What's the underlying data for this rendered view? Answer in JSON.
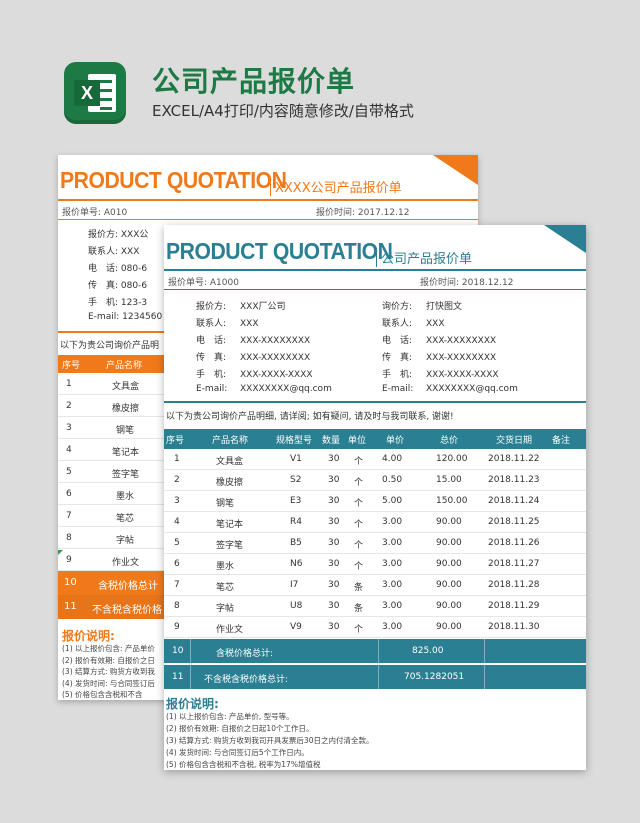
{
  "header": {
    "icon_name": "excel-icon",
    "title": "公司产品报价单",
    "subtitle": "EXCEL/A4打印/内容随意修改/自带格式"
  },
  "colors": {
    "green": "#1e7a45",
    "orange": "#f07a1a",
    "teal": "#2b7f92"
  },
  "back_sheet": {
    "title": "PRODUCT QUOTATION",
    "subtitle": "XXXX公司产品报价单",
    "quote_no": "报价单号: A010",
    "quote_time": "报价时间: 2017.12.12",
    "contacts": [
      "报价方: XXX公",
      "联系人: XXX",
      "电　话: 080-6",
      "传　真: 080-6",
      "手　机: 123-3",
      "E-mail: 1234560"
    ],
    "note": "以下为贵公司询价产品明",
    "headers": [
      "序号",
      "产品名称"
    ],
    "rows": [
      {
        "no": "1",
        "name": "文具盒"
      },
      {
        "no": "2",
        "name": "橡皮擦"
      },
      {
        "no": "3",
        "name": "钢笔"
      },
      {
        "no": "4",
        "name": "笔记本"
      },
      {
        "no": "5",
        "name": "签字笔"
      },
      {
        "no": "6",
        "name": "墨水"
      },
      {
        "no": "7",
        "name": "笔芯"
      },
      {
        "no": "8",
        "name": "字帖"
      },
      {
        "no": "9",
        "name": "作业文"
      }
    ],
    "sum_rows": [
      {
        "no": "10",
        "label": "含税价格总计"
      },
      {
        "no": "11",
        "label": "不含税含税价格"
      }
    ],
    "notes_title": "报价说明:",
    "notes": [
      "(1)  以上报价包含: 产品单价",
      "(2)  报价有效期: 自报价之日",
      "(3)  结算方式: 购货方收到我",
      "(4)  发货时间: 与合同签订后",
      "(5)  价格包含含税和不含"
    ]
  },
  "front_sheet": {
    "title": "PRODUCT QUOTATION",
    "subtitle": "公司产品报价单",
    "quote_no": "报价单号: A1000",
    "quote_time": "报价时间: 2018.12.12",
    "left_contacts": [
      {
        "label": "报价方:",
        "value": "XXX厂公司"
      },
      {
        "label": "联系人:",
        "value": "XXX"
      },
      {
        "label": "电　话:",
        "value": "XXX-XXXXXXXX"
      },
      {
        "label": "传　真:",
        "value": "XXX-XXXXXXXX"
      },
      {
        "label": "手　机:",
        "value": "XXX-XXXX-XXXX"
      },
      {
        "label": "E-mail:",
        "value": "XXXXXXXX@qq.com"
      }
    ],
    "right_contacts": [
      {
        "label": "询价方:",
        "value": "打快图文"
      },
      {
        "label": "联系人:",
        "value": "XXX"
      },
      {
        "label": "电　话:",
        "value": "XXX-XXXXXXXX"
      },
      {
        "label": "传　真:",
        "value": "XXX-XXXXXXXX"
      },
      {
        "label": "手　机:",
        "value": "XXX-XXXX-XXXX"
      },
      {
        "label": "E-mail:",
        "value": "XXXXXXXX@qq.com"
      }
    ],
    "note": "以下为贵公司询价产品明细, 请详阅; 如有疑问, 请及时与我司联系, 谢谢!",
    "headers": [
      "序号",
      "产品名称",
      "规格型号",
      "数量",
      "单位",
      "单价",
      "总价",
      "交货日期",
      "备注"
    ],
    "rows": [
      {
        "no": "1",
        "name": "文具盒",
        "model": "V1",
        "qty": "30",
        "unit": "个",
        "price": "4.00",
        "total": "120.00",
        "date": "2018.11.22"
      },
      {
        "no": "2",
        "name": "橡皮擦",
        "model": "S2",
        "qty": "30",
        "unit": "个",
        "price": "0.50",
        "total": "15.00",
        "date": "2018.11.23"
      },
      {
        "no": "3",
        "name": "钢笔",
        "model": "E3",
        "qty": "30",
        "unit": "个",
        "price": "5.00",
        "total": "150.00",
        "date": "2018.11.24"
      },
      {
        "no": "4",
        "name": "笔记本",
        "model": "R4",
        "qty": "30",
        "unit": "个",
        "price": "3.00",
        "total": "90.00",
        "date": "2018.11.25"
      },
      {
        "no": "5",
        "name": "签字笔",
        "model": "B5",
        "qty": "30",
        "unit": "个",
        "price": "3.00",
        "total": "90.00",
        "date": "2018.11.26"
      },
      {
        "no": "6",
        "name": "墨水",
        "model": "N6",
        "qty": "30",
        "unit": "个",
        "price": "3.00",
        "total": "90.00",
        "date": "2018.11.27"
      },
      {
        "no": "7",
        "name": "笔芯",
        "model": "I7",
        "qty": "30",
        "unit": "条",
        "price": "3.00",
        "total": "90.00",
        "date": "2018.11.28"
      },
      {
        "no": "8",
        "name": "字帖",
        "model": "U8",
        "qty": "30",
        "unit": "条",
        "price": "3.00",
        "total": "90.00",
        "date": "2018.11.29"
      },
      {
        "no": "9",
        "name": "作业文",
        "model": "V9",
        "qty": "30",
        "unit": "个",
        "price": "3.00",
        "total": "90.00",
        "date": "2018.11.30"
      }
    ],
    "sum_rows": [
      {
        "no": "10",
        "label": "含税价格总计:",
        "value": "825.00"
      },
      {
        "no": "11",
        "label": "不含税含税价格总计:",
        "value": "705.1282051"
      }
    ],
    "notes_title": "报价说明:",
    "notes": [
      "(1)  以上报价包含: 产品单价, 型号等。",
      "(2)  报价有效期: 自报价之日起10个工作日。",
      "(3)  结算方式: 购货方收到我司开具发票后30日之内付清全款。",
      "(4)  发货时间: 与合同签订后5个工作日内。",
      "(5)  价格包含含税和不含税, 税率为17%增值税"
    ]
  }
}
